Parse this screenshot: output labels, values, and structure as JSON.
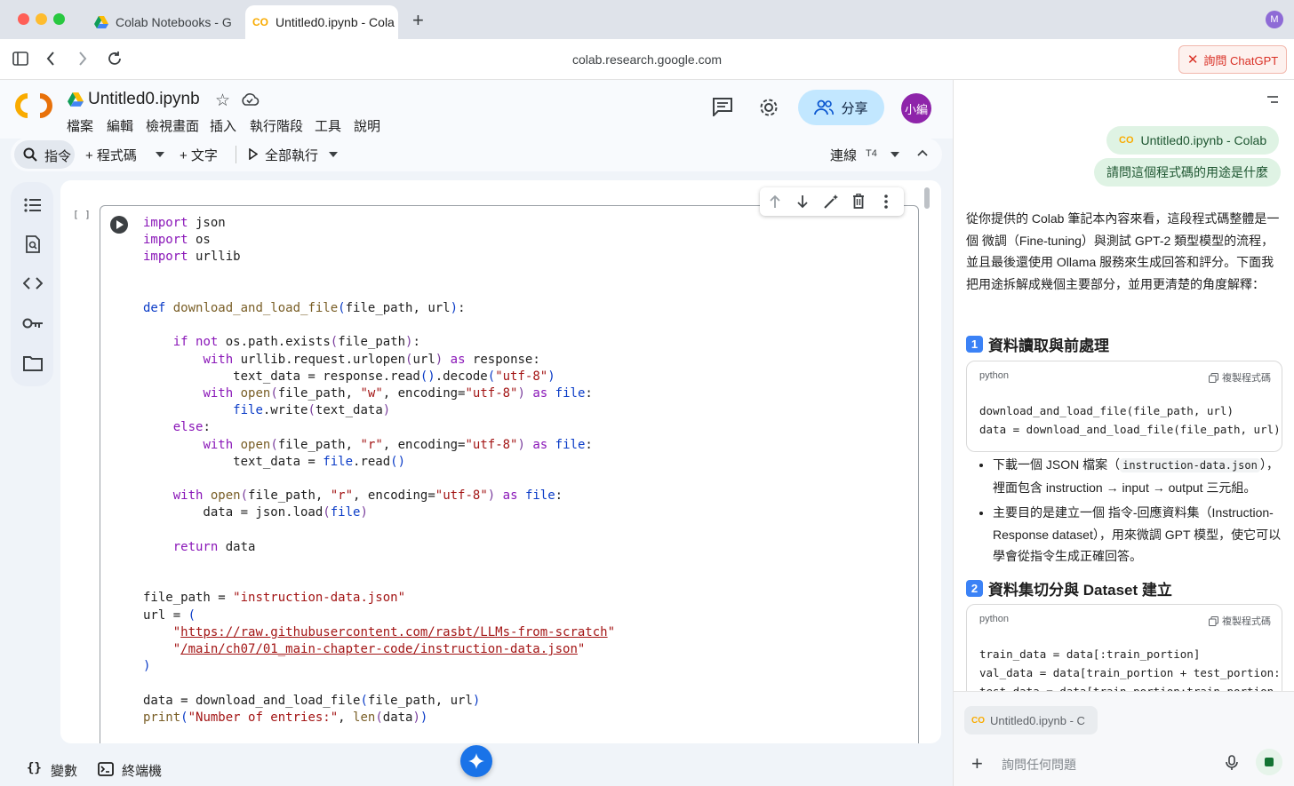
{
  "browser": {
    "tabs": [
      {
        "title": "Colab Notebooks - G"
      },
      {
        "title": "Untitled0.ipynb - Cola"
      }
    ],
    "new_tab": "+",
    "url": "colab.research.google.com",
    "ask_chatgpt": "詢問 ChatGPT",
    "profile_initial": "M"
  },
  "colab": {
    "filename": "Untitled0.ipynb",
    "menu": [
      "檔案",
      "編輯",
      "檢視畫面",
      "插入",
      "執行階段",
      "工具",
      "說明"
    ],
    "share": "分享",
    "avatar": "小編",
    "toolbar": {
      "commands": "指令",
      "code": "+ 程式碼",
      "text": "+ 文字",
      "run_all": "全部執行",
      "connect": "連線",
      "runtime": "T4"
    },
    "cell_exec": "[ ]",
    "bottom": {
      "variables": "變數",
      "terminal": "終端機"
    }
  },
  "panel": {
    "chip_file": "Untitled0.ipynb - Colab",
    "chip_question": "請問這個程式碼的用途是什麼",
    "intro": "從你提供的 Colab 筆記本內容來看，這段程式碼整體是一個 微調（Fine-tuning）與測試 GPT-2 類型模型的流程，並且最後還使用 Ollama 服務來生成回答和評分。下面我把用途拆解成幾個主要部分，並用更清楚的角度解釋：",
    "section1": {
      "num": "1",
      "title": "資料讀取與前處理"
    },
    "code1": {
      "lang": "python",
      "copy": "複製程式碼",
      "lines": [
        "download_and_load_file(file_path, url)",
        "data = download_and_load_file(file_path, url)"
      ]
    },
    "bullets1": [
      {
        "pre": "下載一個 JSON 檔案（",
        "code": "instruction-data.json",
        "post": "），裡面包含 instruction → input → output 三元組。"
      },
      {
        "pre": "主要目的是建立一個 指令-回應資料集（Instruction-Response dataset），用來微調 GPT 模型，使它可以學會從指令生成正確回答。",
        "code": "",
        "post": ""
      }
    ],
    "section2": {
      "num": "2",
      "title": "資料集切分與 Dataset 建立"
    },
    "code2": {
      "lang": "python",
      "copy": "複製程式碼",
      "lines": [
        "train_data = data[:train_portion]",
        "val_data = data[train_portion + test_portion:]",
        "test_data = data[train_portion:train_portion + "
      ]
    },
    "attachment": "Untitled0.ipynb - C",
    "input_placeholder": "詢問任何問題"
  }
}
